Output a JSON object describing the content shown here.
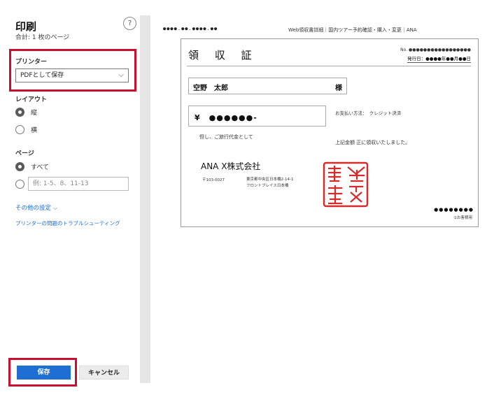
{
  "dialog": {
    "title": "印刷",
    "summary": "合計: 1 枚のページ",
    "help_glyph": "?"
  },
  "printer": {
    "label": "プリンター",
    "selected": "PDFとして保存"
  },
  "layout": {
    "label": "レイアウト",
    "options": [
      "縦",
      "横"
    ],
    "selected": "縦"
  },
  "pages": {
    "label": "ページ",
    "option_all": "すべて",
    "selected": "すべて",
    "custom_placeholder": "例: 1-5、8、11-13"
  },
  "links": {
    "more_settings": "その他の設定 ⌵",
    "troubleshoot": "プリンターの問題のトラブルシューティング"
  },
  "buttons": {
    "save": "保存",
    "cancel": "キャンセル"
  },
  "preview": {
    "header_left": "●●●●.●●.●●●●.●●",
    "header_right": "Web領収書詳細｜国内ツアー予約確認・購入・変更｜ANA",
    "receipt": {
      "title": "領 収 証",
      "no": "No. ●●●●●●●●●●●●●●●●●",
      "issue_date": "発行日：●●●●年●●月●●日",
      "name": "空野　太郎",
      "honorific": "様",
      "amount": "¥　●●●●●●-",
      "payment": "お支払い方法：　クレジット決済",
      "note": "但し、ご旅行代金として",
      "received": "上記金額 正に領収いたしました。",
      "company": "ANA X株式会社",
      "zip": "〒103-0027",
      "address_line1": "東京都中央区日本橋2-14-1",
      "address_line2": "フロントプレイス日本橋",
      "trailing": "●●●●●●●●",
      "copy_label": "①お客様用"
    }
  },
  "colors": {
    "accent": "#1f6ed4",
    "highlight": "#c8102e",
    "stamp": "#d62b2b"
  }
}
